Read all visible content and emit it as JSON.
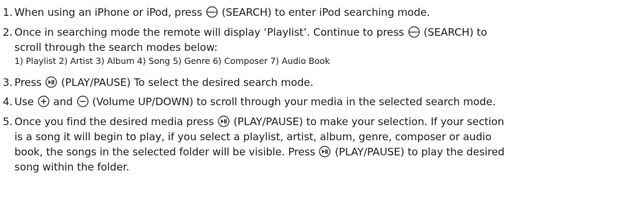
{
  "steps": [
    {
      "num": "1.",
      "l1a": "When using an iPhone or iPod, press",
      "l1b": "(SEARCH) to enter iPod searching mode."
    },
    {
      "num": "2.",
      "l1a": "Once in searching mode the remote will display ‘Playlist’. Continue to press",
      "l1b": "(SEARCH) to",
      "l2": "scroll through the search modes below:",
      "sub": "1) Playlist 2) Artist 3) Album 4) Song 5) Genre 6) Composer 7) Audio Book"
    },
    {
      "num": "3.",
      "l1a": "Press",
      "l1b": "(PLAY/PAUSE) To select the desired search mode."
    },
    {
      "num": "4.",
      "l1a": "Use",
      "l1b": "and",
      "l1c": "(Volume UP/DOWN) to scroll through your media in the selected search mode."
    },
    {
      "num": "5.",
      "l1a": "Once you find the desired media press",
      "l1b": "(PLAY/PAUSE) to make your selection. If your section",
      "l2": "is a song it will begin to play, if you select a playlist, artist, album, genre, composer or audio",
      "l3": "book, the songs in the selected folder will be visible. Press",
      "l3b": "(PLAY/PAUSE) to play the desired",
      "l4": "song within the folder."
    }
  ],
  "icons": {
    "search_label": "SEARCH"
  }
}
